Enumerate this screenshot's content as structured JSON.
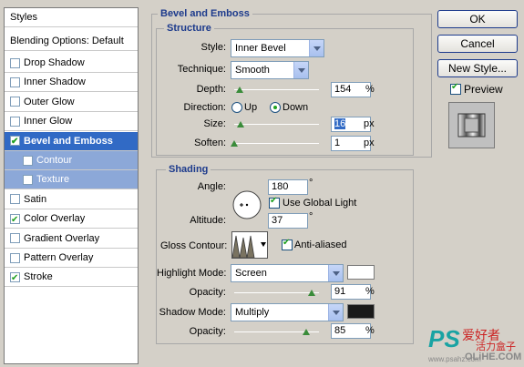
{
  "styles_panel": {
    "header": "Styles",
    "blending": "Blending Options: Default",
    "items": [
      {
        "label": "Drop Shadow",
        "checked": false
      },
      {
        "label": "Inner Shadow",
        "checked": false
      },
      {
        "label": "Outer Glow",
        "checked": false
      },
      {
        "label": "Inner Glow",
        "checked": false
      },
      {
        "label": "Bevel and Emboss",
        "checked": true,
        "selected": true
      },
      {
        "label": "Contour",
        "checked": false,
        "sub": true
      },
      {
        "label": "Texture",
        "checked": false,
        "sub": true
      },
      {
        "label": "Satin",
        "checked": false
      },
      {
        "label": "Color Overlay",
        "checked": true
      },
      {
        "label": "Gradient Overlay",
        "checked": false
      },
      {
        "label": "Pattern Overlay",
        "checked": false
      },
      {
        "label": "Stroke",
        "checked": true
      }
    ]
  },
  "bevel": {
    "title": "Bevel and Emboss",
    "structure_title": "Structure",
    "style_label": "Style:",
    "style_value": "Inner Bevel",
    "technique_label": "Technique:",
    "technique_value": "Smooth",
    "depth_label": "Depth:",
    "depth_value": "154",
    "depth_unit": "%",
    "depth_level": 0.06,
    "direction_label": "Direction:",
    "dir_up": "Up",
    "dir_down": "Down",
    "size_label": "Size:",
    "size_value": "16",
    "size_unit": "px",
    "size_level": 0.08,
    "soften_label": "Soften:",
    "soften_value": "1",
    "soften_unit": "px",
    "soften_level": 0.0
  },
  "shading": {
    "title": "Shading",
    "angle_label": "Angle:",
    "angle_value": "180",
    "angle_unit": "°",
    "global_light": "Use Global Light",
    "altitude_label": "Altitude:",
    "altitude_value": "37",
    "altitude_unit": "°",
    "gloss_label": "Gloss Contour:",
    "anti_aliased": "Anti-aliased",
    "highlight_label": "Highlight Mode:",
    "highlight_value": "Screen",
    "highlight_color": "#ffffff",
    "h_opacity_label": "Opacity:",
    "h_opacity_value": "91",
    "h_opacity_unit": "%",
    "h_opacity_level": 0.91,
    "shadow_label": "Shadow Mode:",
    "shadow_value": "Multiply",
    "shadow_color": "#1a1a1a",
    "s_opacity_label": "Opacity:",
    "s_opacity_value": "85",
    "s_opacity_unit": "%",
    "s_opacity_level": 0.85
  },
  "buttons": {
    "ok": "OK",
    "cancel": "Cancel",
    "new_style": "New Style...",
    "preview": "Preview"
  },
  "watermark": {
    "ps": "PS",
    "cn1": "爱好者",
    "cn2": "活力盒子",
    "site": "OLiHE.COM",
    "url": "www.psahz.com"
  }
}
